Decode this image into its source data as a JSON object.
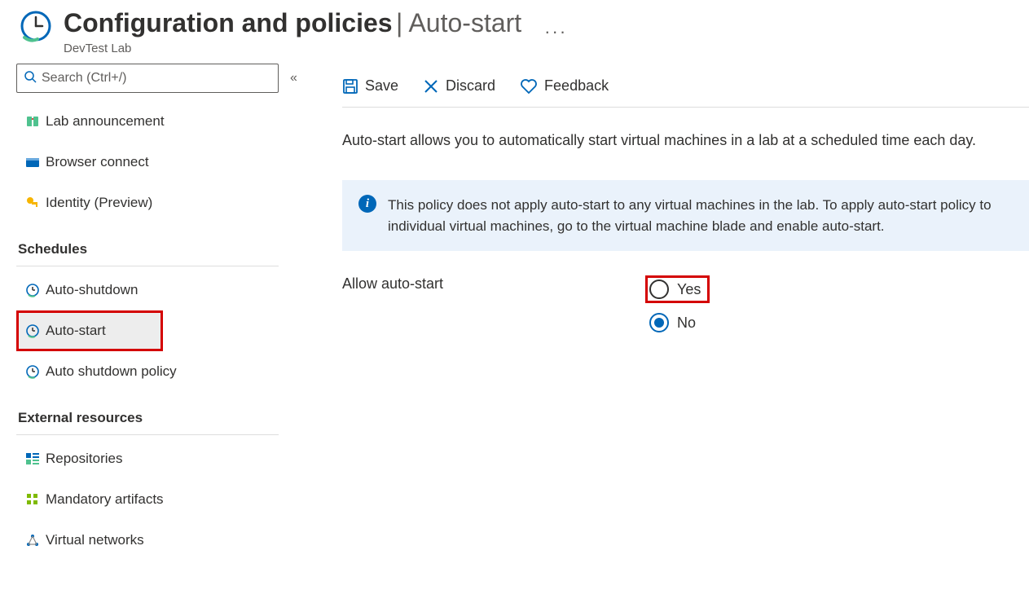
{
  "header": {
    "title": "Configuration and policies",
    "subtitle": "Auto-start",
    "crumb": "DevTest Lab"
  },
  "search": {
    "placeholder": "Search (Ctrl+/)"
  },
  "nav": {
    "lab_announcement": "Lab announcement",
    "browser_connect": "Browser connect",
    "identity_preview": "Identity (Preview)",
    "section_schedules": "Schedules",
    "auto_shutdown": "Auto-shutdown",
    "auto_start": "Auto-start",
    "auto_shutdown_policy": "Auto shutdown policy",
    "section_external": "External resources",
    "repositories": "Repositories",
    "mandatory_artifacts": "Mandatory artifacts",
    "virtual_networks": "Virtual networks"
  },
  "toolbar": {
    "save": "Save",
    "discard": "Discard",
    "feedback": "Feedback"
  },
  "main": {
    "description": "Auto-start allows you to automatically start virtual machines in a lab at a scheduled time each day.",
    "info": "This policy does not apply auto-start to any virtual machines in the lab. To apply auto-start policy to individual virtual machines, go to the virtual machine blade and enable auto-start.",
    "form_label": "Allow auto-start",
    "yes": "Yes",
    "no": "No"
  }
}
